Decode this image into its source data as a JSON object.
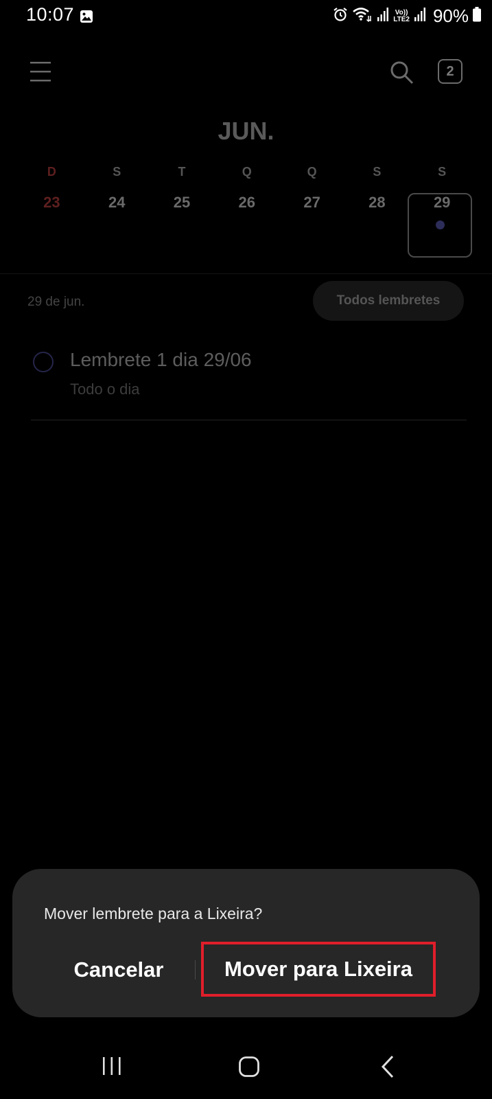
{
  "status_bar": {
    "time": "10:07",
    "battery": "90%",
    "lte_top": "Vo))",
    "lte_bottom": "LTE2",
    "icons": [
      "gallery-icon",
      "alarm-icon",
      "wifi-icon",
      "signal-icon",
      "signal-icon",
      "battery-icon"
    ]
  },
  "header": {
    "today_badge": "2",
    "icons": [
      "menu-icon",
      "search-icon"
    ]
  },
  "calendar": {
    "month": "JUN.",
    "days": [
      {
        "letter": "D",
        "num": "23",
        "weekday": "sunday"
      },
      {
        "letter": "S",
        "num": "24"
      },
      {
        "letter": "T",
        "num": "25"
      },
      {
        "letter": "Q",
        "num": "26"
      },
      {
        "letter": "Q",
        "num": "27"
      },
      {
        "letter": "S",
        "num": "28"
      },
      {
        "letter": "S",
        "num": "29",
        "selected": true,
        "has_event": true
      }
    ]
  },
  "list": {
    "date_label": "29 de jun.",
    "filter_button": "Todos lembretes",
    "items": [
      {
        "title": "Lembrete 1 dia 29/06",
        "subtitle": "Todo o dia"
      }
    ]
  },
  "dialog": {
    "message": "Mover lembrete para a Lixeira?",
    "cancel": "Cancelar",
    "confirm": "Mover para Lixeira",
    "highlight_color": "#e01e2b"
  },
  "nav_bar": {
    "icons": [
      "recents-icon",
      "home-icon",
      "back-icon"
    ]
  },
  "colors": {
    "background": "#000000",
    "dialog_bg": "#272727",
    "event_dot": "#2d2d5a"
  }
}
